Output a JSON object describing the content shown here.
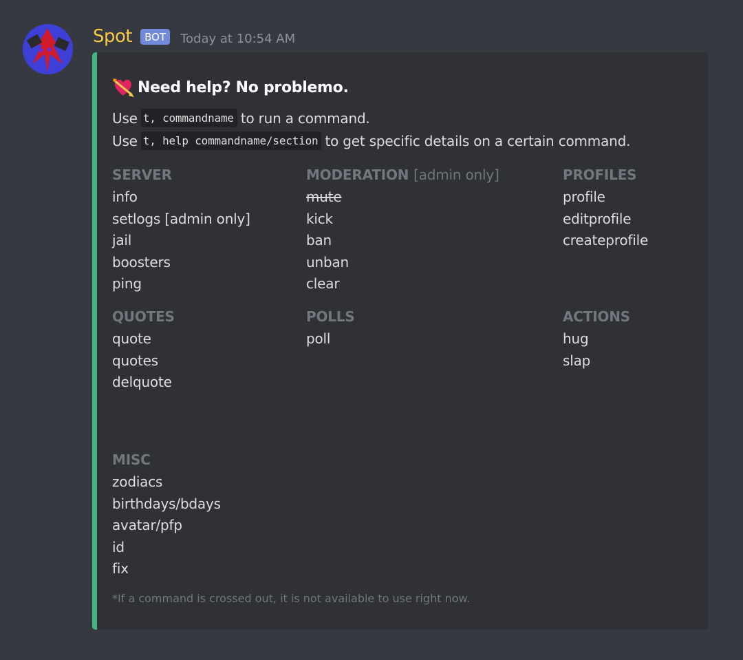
{
  "message": {
    "username": "Spot",
    "bot_tag": "BOT",
    "timestamp": "Today at 10:54 AM",
    "username_color": "#f7c948",
    "embed_color": "#43b581"
  },
  "embed": {
    "title_emoji": "heart-with-arrow-icon",
    "title": "Need help? No problemo.",
    "desc1": {
      "pre": "Use",
      "code": "t, commandname",
      "post": "to run a command."
    },
    "desc2": {
      "pre": "Use",
      "code": "t, help commandname/section",
      "post": "to get specific details on a certain command."
    },
    "fields": {
      "server": {
        "name": "SERVER",
        "items": [
          "info",
          "setlogs [admin only]",
          "jail",
          "boosters",
          "ping"
        ]
      },
      "moderation": {
        "name": "MODERATION",
        "sub": "[admin only]",
        "items": [
          "mute",
          "kick",
          "ban",
          "unban",
          "clear"
        ],
        "struck": [
          "mute"
        ]
      },
      "profiles": {
        "name": "PROFILES",
        "items": [
          "profile",
          "editprofile",
          "createprofile"
        ]
      },
      "quotes": {
        "name": "QUOTES",
        "items": [
          "quote",
          "quotes",
          "delquote"
        ]
      },
      "polls": {
        "name": "POLLS",
        "items": [
          "poll"
        ]
      },
      "actions": {
        "name": "ACTIONS",
        "items": [
          "hug",
          "slap"
        ]
      },
      "misc": {
        "name": "MISC",
        "items": [
          "zodiacs",
          "birthdays/bdays",
          "avatar/pfp",
          "id",
          "fix"
        ]
      }
    },
    "footer_note": "*If a command is crossed out, it is not available to use right now."
  }
}
